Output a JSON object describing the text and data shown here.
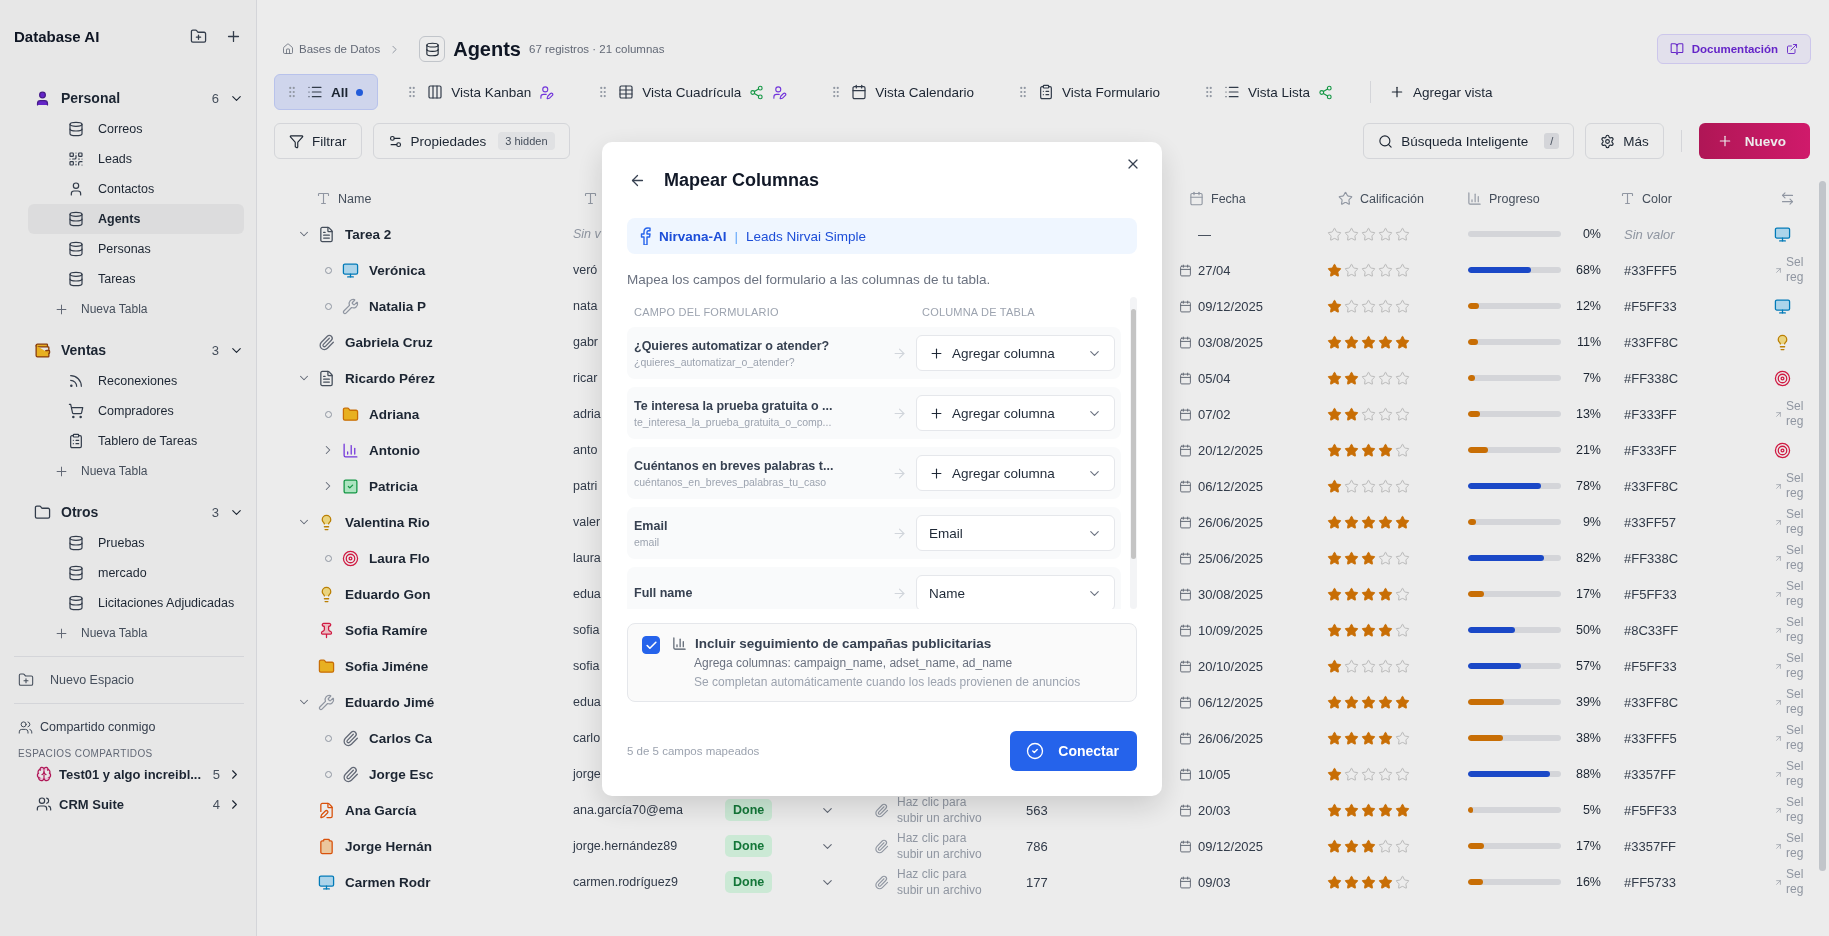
{
  "sidebar": {
    "title": "Database AI",
    "groups": [
      {
        "name": "Personal",
        "count": "6",
        "expanded": true,
        "add_label": "Nueva Tabla",
        "items": [
          {
            "label": "Correos",
            "selected": false
          },
          {
            "label": "Leads",
            "selected": false
          },
          {
            "label": "Contactos",
            "selected": false
          },
          {
            "label": "Agents",
            "selected": true
          },
          {
            "label": "Personas",
            "selected": false
          },
          {
            "label": "Tareas",
            "selected": false
          }
        ]
      },
      {
        "name": "Ventas",
        "count": "3",
        "expanded": true,
        "add_label": "Nueva Tabla",
        "items": [
          {
            "label": "Reconexiones",
            "selected": false
          },
          {
            "label": "Compradores",
            "selected": false
          },
          {
            "label": "Tablero de Tareas",
            "selected": false
          }
        ]
      },
      {
        "name": "Otros",
        "count": "3",
        "expanded": true,
        "add_label": "Nueva Tabla",
        "items": [
          {
            "label": "Pruebas",
            "selected": false
          },
          {
            "label": "mercado",
            "selected": false
          },
          {
            "label": "Licitaciones Adjudicadas",
            "selected": false
          }
        ]
      }
    ],
    "new_space": "Nuevo Espacio",
    "shared_with_me": "Compartido conmigo",
    "shared_heading": "ESPACIOS COMPARTIDOS",
    "shared_spaces": [
      {
        "name": "Test01 y algo increibl...",
        "count": "5"
      },
      {
        "name": "CRM Suite",
        "count": "4"
      }
    ]
  },
  "header": {
    "breadcrumb": "Bases de Datos",
    "title": "Agents",
    "meta": "67 registros · 21 columnas",
    "docs_button": "Documentación"
  },
  "views": [
    {
      "label": "All",
      "selected": true,
      "dot": true,
      "shared": false,
      "assigned": false
    },
    {
      "label": "Vista Kanban",
      "selected": false,
      "dot": false,
      "shared": false,
      "assigned": true
    },
    {
      "label": "Vista Cuadrícula",
      "selected": false,
      "dot": false,
      "shared": true,
      "assigned": true
    },
    {
      "label": "Vista Calendario",
      "selected": false,
      "dot": false,
      "shared": false,
      "assigned": false
    },
    {
      "label": "Vista Formulario",
      "selected": false,
      "dot": false,
      "shared": false,
      "assigned": false
    },
    {
      "label": "Vista Lista",
      "selected": false,
      "dot": false,
      "shared": true,
      "assigned": false
    }
  ],
  "add_view": "Agregar vista",
  "toolbar": {
    "filter": "Filtrar",
    "properties": "Propiedades",
    "hidden_badge": "3 hidden",
    "search": "Búsqueda Inteligente",
    "search_key": "/",
    "more": "Más",
    "new": "Nuevo"
  },
  "table": {
    "columns": [
      {
        "label": "Name"
      },
      {},
      {
        "label": "Fecha"
      },
      {
        "label": "Calificación"
      },
      {
        "label": "Progreso"
      },
      {
        "label": "Color"
      },
      {}
    ],
    "rows": [
      {
        "name": "Tarea 2",
        "expanded": true,
        "email": "Sin v",
        "email_empty": true,
        "date": "—",
        "stars": 0,
        "level": 0,
        "reading": "0%",
        "color_text": "Sin valor",
        "color_empty": true,
        "last": {
          "kind": "icon"
        },
        "children": [
          {
            "name": "Verónica",
            "email": "veró",
            "email_empty": false,
            "date": "27/04",
            "stars": 1,
            "level": 0.68,
            "reading": "68%",
            "color_text": "#33FFF5",
            "color_empty": false,
            "last": {
              "kind": "link",
              "text": "Sel reg"
            }
          },
          {
            "name": "Natalia P",
            "email": "nata",
            "email_empty": false,
            "date": "09/12/2025",
            "stars": 1,
            "level": 0.12,
            "reading": "12%",
            "color_text": "#F5FF33",
            "color_empty": false,
            "last": {
              "kind": "icon"
            }
          }
        ]
      },
      {
        "name": "Gabriela Cruz",
        "email": "gabr",
        "email_empty": false,
        "date": "03/08/2025",
        "stars": 5,
        "level": 0.11,
        "reading": "11%",
        "color_text": "#33FF8C",
        "color_empty": false,
        "last": {
          "kind": "icon"
        }
      },
      {
        "name": "Ricardo Pérez",
        "expanded": true,
        "email": "ricar",
        "email_empty": false,
        "date": "05/04",
        "stars": 2,
        "level": 0.07,
        "reading": "7%",
        "color_text": "#FF338C",
        "color_empty": false,
        "last": {
          "kind": "icon"
        },
        "children": [
          {
            "name": "Adriana",
            "email": "adria",
            "email_empty": false,
            "date": "07/02",
            "stars": 2,
            "level": 0.13,
            "reading": "13%",
            "color_text": "#F333FF",
            "color_empty": false,
            "last": {
              "kind": "link",
              "text": "Sel reg"
            }
          },
          {
            "name": "Antonio",
            "expanded": false,
            "email": "anto",
            "email_empty": false,
            "date": "20/12/2025",
            "stars": 4,
            "level": 0.21,
            "reading": "21%",
            "color_text": "#F333FF",
            "color_empty": false,
            "last": {
              "kind": "icon"
            }
          },
          {
            "name": "Patricia",
            "expanded": false,
            "email": "patri",
            "email_empty": false,
            "date": "06/12/2025",
            "stars": 1,
            "level": 0.78,
            "reading": "78%",
            "color_text": "#33FF8C",
            "color_empty": false,
            "last": {
              "kind": "link",
              "text": "Sel reg"
            }
          }
        ]
      },
      {
        "name": "Valentina Rio",
        "expanded": true,
        "email": "valer",
        "email_empty": false,
        "date": "26/06/2025",
        "stars": 5,
        "level": 0.09,
        "reading": "9%",
        "color_text": "#33FF57",
        "color_empty": false,
        "last": {
          "kind": "link",
          "text": "Sel reg"
        },
        "children": [
          {
            "name": "Laura Flo",
            "email": "laura",
            "email_empty": false,
            "date": "25/06/2025",
            "stars": 3,
            "level": 0.82,
            "reading": "82%",
            "color_text": "#FF338C",
            "color_empty": false,
            "last": {
              "kind": "link",
              "text": "Sel reg"
            }
          }
        ]
      },
      {
        "name": "Eduardo Gon",
        "email": "edua",
        "email_empty": false,
        "date": "30/08/2025",
        "stars": 4,
        "level": 0.17,
        "reading": "17%",
        "color_text": "#F5FF33",
        "color_empty": false,
        "last": {
          "kind": "link",
          "text": "Sel reg"
        }
      },
      {
        "name": "Sofia Ramíre",
        "email": "sofia",
        "email_empty": false,
        "date": "10/09/2025",
        "stars": 4,
        "level": 0.5,
        "reading": "50%",
        "color_text": "#8C33FF",
        "color_empty": false,
        "last": {
          "kind": "link",
          "text": "Sel reg"
        }
      },
      {
        "name": "Sofia Jiméne",
        "email": "sofia",
        "email_empty": false,
        "date": "20/10/2025",
        "stars": 1,
        "level": 0.57,
        "reading": "57%",
        "color_text": "#F5FF33",
        "color_empty": false,
        "last": {
          "kind": "link",
          "text": "Sel reg"
        }
      },
      {
        "name": "Eduardo Jimé",
        "expanded": true,
        "email": "edua",
        "email_empty": false,
        "date": "06/12/2025",
        "stars": 5,
        "level": 0.39,
        "reading": "39%",
        "color_text": "#33FF8C",
        "color_empty": false,
        "last": {
          "kind": "link",
          "text": "Sel reg"
        },
        "children": [
          {
            "name": "Carlos Ca",
            "email": "carlo",
            "email_empty": false,
            "date": "26/06/2025",
            "stars": 4,
            "level": 0.38,
            "reading": "38%",
            "color_text": "#33FFF5",
            "color_empty": false,
            "last": {
              "kind": "link",
              "text": "Sel reg"
            }
          },
          {
            "name": "Jorge Esc",
            "email": "jorge",
            "email_empty": false,
            "date": "10/05",
            "stars": 1,
            "level": 0.88,
            "reading": "88%",
            "color_text": "#3357FF",
            "color_empty": false,
            "last": {
              "kind": "link",
              "text": "Sel reg"
            }
          }
        ]
      },
      {
        "name": "Ana García",
        "email": "ana.garcía70@ema",
        "email_empty": false,
        "status": "Done",
        "attachment": "Haz clic para subir un archivo",
        "number": "563",
        "date": "20/03",
        "stars": 5,
        "level": 0.05,
        "reading": "5%",
        "color_text": "#F5FF33",
        "color_empty": false,
        "last": {
          "kind": "link",
          "text": "Sel reg"
        }
      },
      {
        "name": "Jorge Hernán",
        "email": "jorge.hernández89",
        "email_empty": false,
        "status": "Done",
        "attachment": "Haz clic para subir un archivo",
        "number": "786",
        "date": "09/12/2025",
        "stars": 3,
        "level": 0.17,
        "reading": "17%",
        "color_text": "#3357FF",
        "color_empty": false,
        "last": {
          "kind": "link",
          "text": "Sel reg"
        }
      },
      {
        "name": "Carmen Rodr",
        "email": "carmen.rodríguez9",
        "email_empty": false,
        "status": "Done",
        "attachment": "Haz clic para subir un archivo",
        "number": "177",
        "date": "09/03",
        "stars": 4,
        "level": 0.16,
        "reading": "16%",
        "color_text": "#FF5733",
        "color_empty": false,
        "last": {
          "kind": "link",
          "text": "Sel reg"
        }
      }
    ]
  },
  "dialog": {
    "title": "Mapear Columnas",
    "source": {
      "account": "Nirvana-AI",
      "separator": "|",
      "form": "Leads Nirvai Simple"
    },
    "description": "Mapea los campos del formulario a las columnas de tu tabla.",
    "headers": [
      "CAMPO DEL FORMULARIO",
      "COLUMNA DE TABLA"
    ],
    "mappings": [
      {
        "label": "¿Quieres automatizar o atender?",
        "key": "¿quieres_automatizar_o_atender?",
        "kind": "new",
        "value": "Agregar columna"
      },
      {
        "label": "Te interesa la prueba gratuita o ...",
        "key": "te_interesa_la_prueba_gratuita_o_comp...",
        "kind": "new",
        "value": "Agregar columna"
      },
      {
        "label": "Cuéntanos en breves palabras t...",
        "key": "cuéntanos_en_breves_palabras_tu_caso",
        "kind": "new",
        "value": "Agregar columna"
      },
      {
        "label": "Email",
        "key": "email",
        "kind": "mapped",
        "value": "Email"
      },
      {
        "label": "Full name",
        "kind": "mapped",
        "value": "Name"
      }
    ],
    "tracking": {
      "checked": true,
      "title": "Incluir seguimiento de campañas publicitarias",
      "lines": [
        "Agrega columnas: campaign_name, adset_name, ad_name",
        "Se completan automáticamente cuando los leads provienen de anuncios"
      ]
    },
    "status": "5 de 5 campos mapeados",
    "confirm": "Conectar"
  }
}
